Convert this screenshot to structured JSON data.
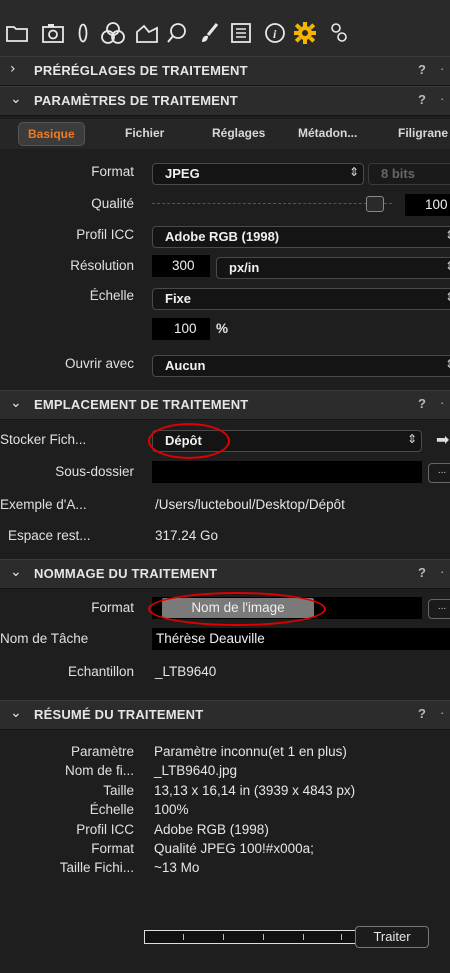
{
  "toolbar": {
    "icons": [
      "folder-icon",
      "camera-icon",
      "lens-icon",
      "color-icon",
      "exposure-icon",
      "search-icon",
      "brush-icon",
      "list-icon",
      "info-icon",
      "gear-icon",
      "settings-icon"
    ],
    "active_color": "#f5b400"
  },
  "sections": {
    "presets": {
      "title": "PRÉRÉGLAGES DE TRAITEMENT",
      "help": "?"
    },
    "params": {
      "title": "PARAMÈTRES DE TRAITEMENT",
      "help": "?"
    },
    "location": {
      "title": "EMPLACEMENT DE TRAITEMENT",
      "help": "?"
    },
    "naming": {
      "title": "NOMMAGE DU TRAITEMENT",
      "help": "?"
    },
    "summary": {
      "title": "RÉSUMÉ DU TRAITEMENT",
      "help": "?"
    }
  },
  "tabs": [
    "Basique",
    "Fichier",
    "Réglages",
    "Métadon...",
    "Filigrane"
  ],
  "basic": {
    "format_label": "Format",
    "format_value": "JPEG",
    "bits_value": "8 bits",
    "quality_label": "Qualité",
    "quality_value": "100",
    "icc_label": "Profil ICC",
    "icc_value": "Adobe RGB (1998)",
    "res_label": "Résolution",
    "res_value": "300",
    "res_unit": "px/in",
    "scale_label": "Échelle",
    "scale_value": "Fixe",
    "scale_pct": "100",
    "pct_sign": "%",
    "open_label": "Ouvrir avec",
    "open_value": "Aucun"
  },
  "location": {
    "store_label": "Stocker Fich...",
    "store_value": "Dépôt",
    "subfolder_label": "Sous-dossier",
    "subfolder_value": "",
    "example_label": "Exemple d'A...",
    "example_value": "/Users/lucteboul/Desktop/Dépôt",
    "space_label": "Espace rest...",
    "space_value": "317.24 Go",
    "ellipsis": "..."
  },
  "naming": {
    "format_label": "Format",
    "format_token": "Nom de l'image",
    "job_label": "Nom de Tâche",
    "job_value": "Thérèse Deauville",
    "sample_label": "Echantillon",
    "sample_value": "_LTB9640",
    "ellipsis": "..."
  },
  "summary": {
    "rows": [
      {
        "label": "Paramètre",
        "value": "Paramètre inconnu(et 1 en plus)"
      },
      {
        "label": "Nom de fi...",
        "value": "_LTB9640.jpg"
      },
      {
        "label": "Taille",
        "value": "13,13 x 16,14 in (3939 x 4843 px)"
      },
      {
        "label": "Échelle",
        "value": "100%"
      },
      {
        "label": "Profil ICC",
        "value": "Adobe RGB (1998)"
      },
      {
        "label": "Format",
        "value": "Qualité JPEG 100!#x000a;"
      },
      {
        "label": "Taille Fichi...",
        "value": "~13 Mo"
      }
    ],
    "process_button": "Traiter",
    "progress": 0
  }
}
